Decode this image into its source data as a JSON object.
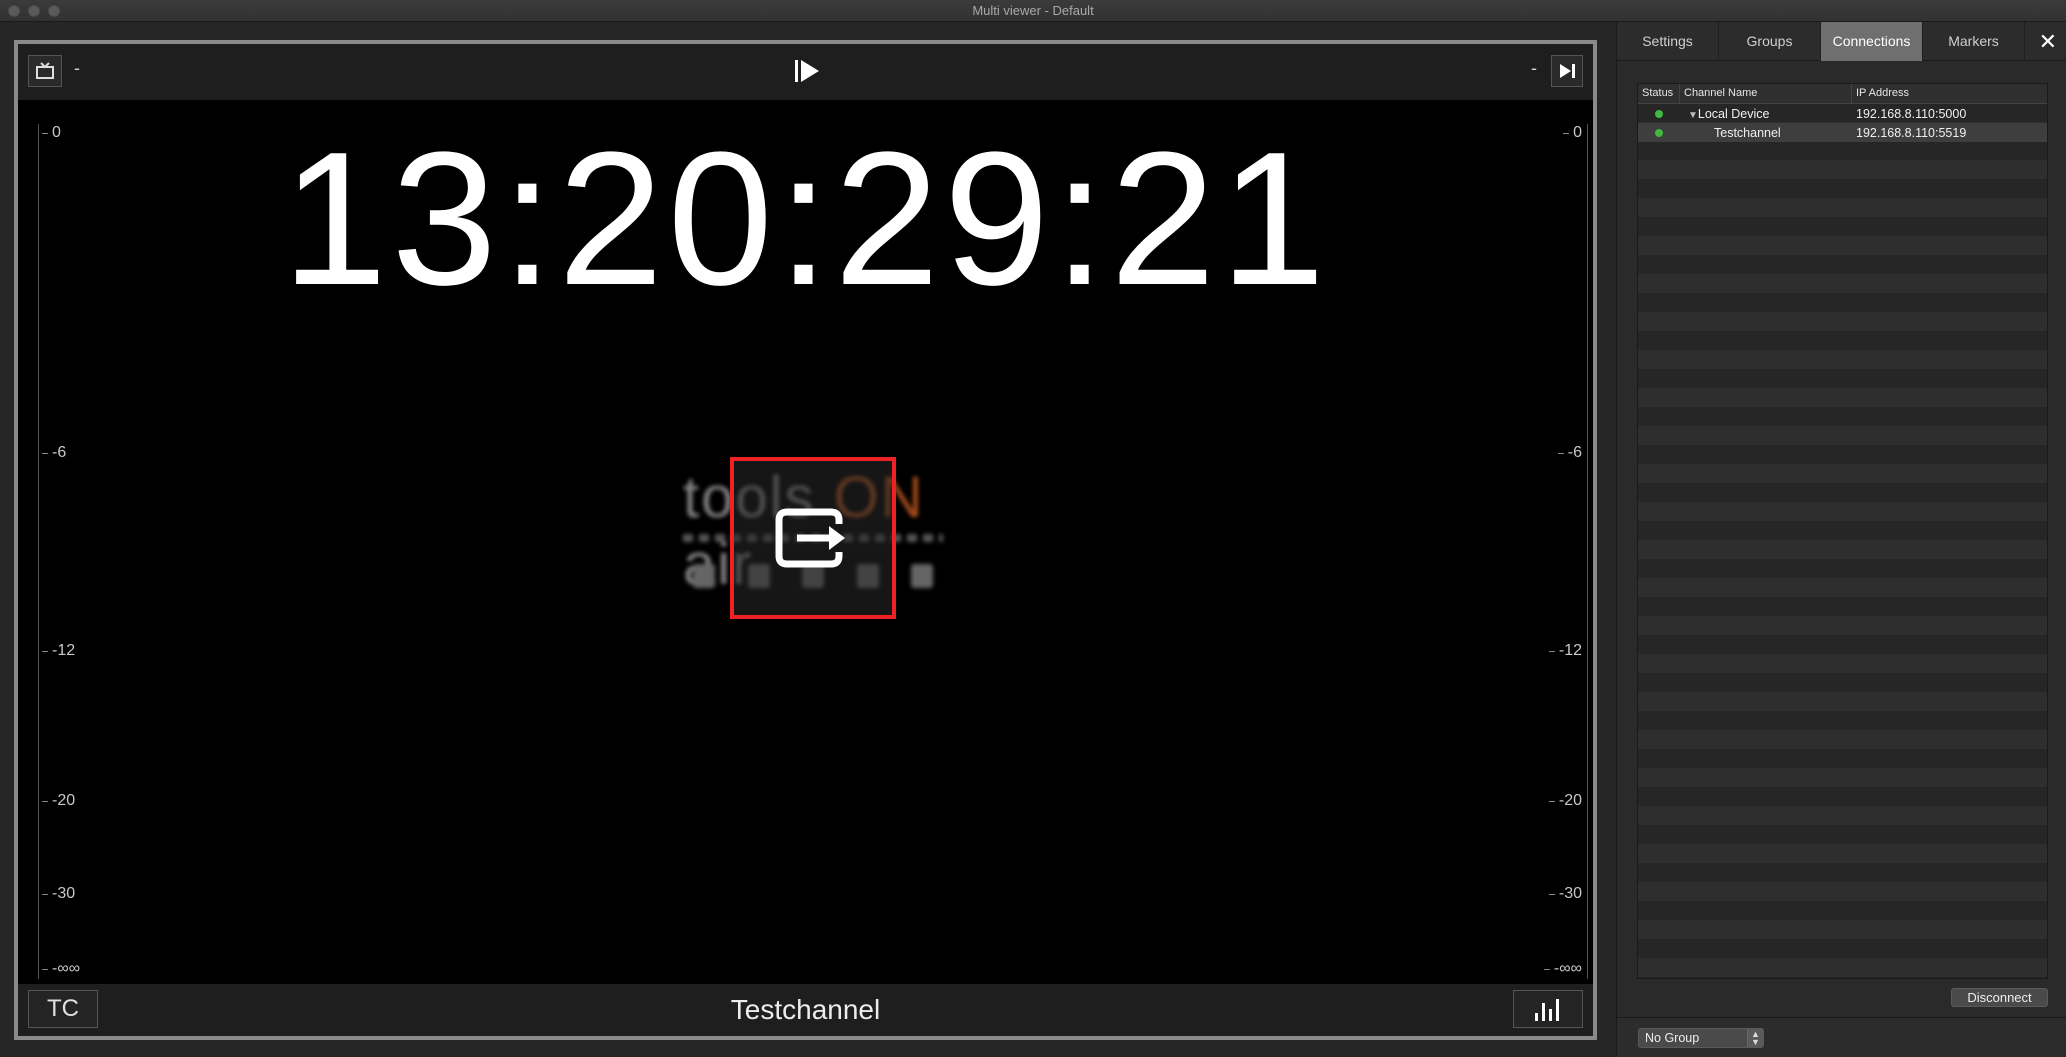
{
  "window": {
    "title": "Multi viewer - Default"
  },
  "viewer": {
    "timecode": "13:20:29:21",
    "channel_name": "Testchannel",
    "left_dash": "-",
    "right_dash": "-",
    "tc_label": "TC",
    "logo_text_a": "tools",
    "logo_text_on": "ON",
    "logo_text_b": "air",
    "scale_labels": [
      "0",
      "-6",
      "-12",
      "-20",
      "-30",
      "-∞∞"
    ]
  },
  "panel": {
    "tabs": [
      {
        "label": "Settings"
      },
      {
        "label": "Groups"
      },
      {
        "label": "Connections"
      },
      {
        "label": "Markers"
      }
    ],
    "active_tab": "Connections",
    "close_glyph": "✕",
    "table": {
      "columns": [
        "Status",
        "Channel Name",
        "IP Address"
      ],
      "rows": [
        {
          "status": "connected",
          "name": "Local Device",
          "ip": "192.168.8.110:5000"
        },
        {
          "status": "connected",
          "name": "Testchannel",
          "ip": "192.168.8.110:5519"
        }
      ]
    },
    "disconnect_label": "Disconnect",
    "group_select": {
      "value": "No Group"
    }
  },
  "colors": {
    "status_ok": "#3fb93f",
    "highlight_box": "#e22222",
    "active_tab": "#6f6f6f"
  }
}
